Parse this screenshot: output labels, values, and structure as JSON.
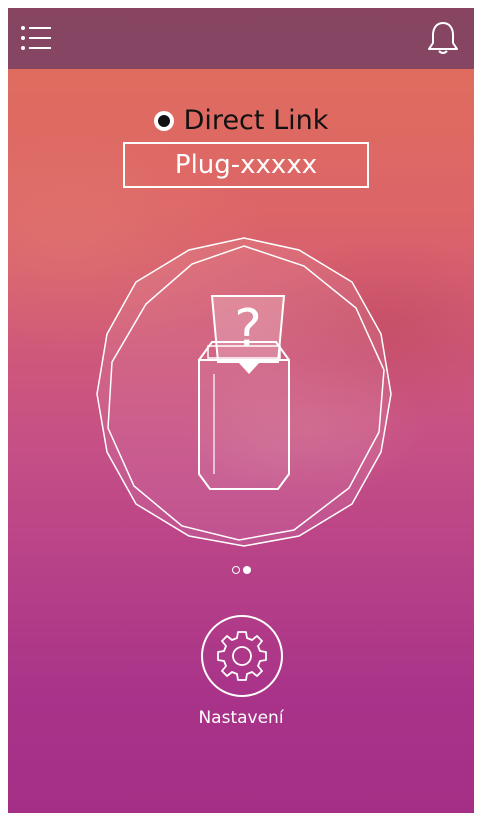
{
  "header": {
    "menu_icon": "menu-list-icon",
    "notification_icon": "bell-icon"
  },
  "connection": {
    "mode_label": "Direct Link",
    "mode_icon": "radio-selected-icon",
    "device_name": "Plug-xxxxx"
  },
  "device_illustration": {
    "icon": "unknown-washing-machine-icon",
    "symbol": "?"
  },
  "pager": {
    "count": 2,
    "active_index": 1
  },
  "settings": {
    "label": "Nastavení",
    "icon": "gear-icon"
  },
  "colors": {
    "topbar": "#733c64",
    "gradient_top": "#e0705a",
    "gradient_bottom": "#a52f86",
    "line": "#ffffff"
  }
}
